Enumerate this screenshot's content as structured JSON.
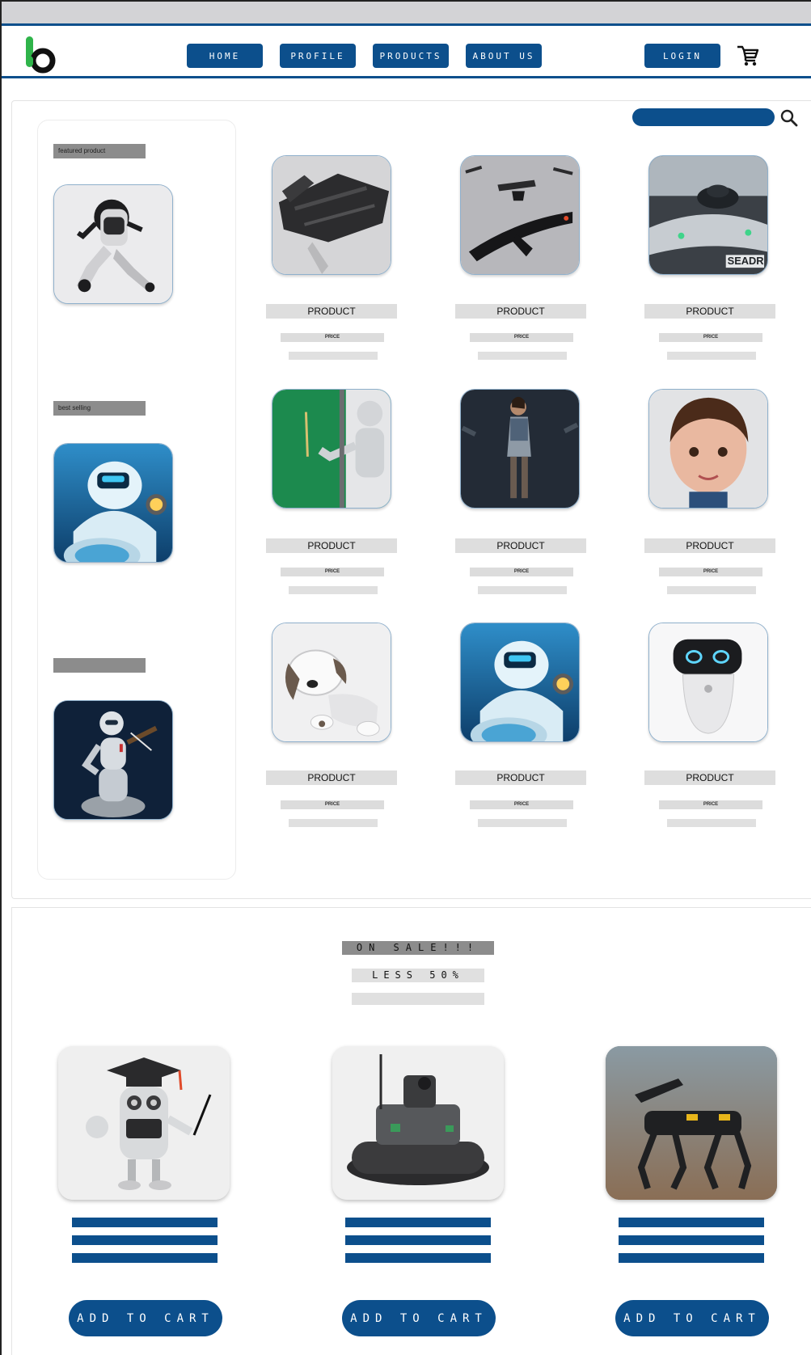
{
  "header": {
    "nav": [
      {
        "label": "HOME"
      },
      {
        "label": "PROFILE"
      },
      {
        "label": "PRODUCTS"
      },
      {
        "label": "ABOUT US"
      }
    ],
    "login_label": "LOGIN"
  },
  "sidebar": {
    "sections": [
      {
        "label": "featured product",
        "image": "humanoid-robot"
      },
      {
        "label": "best selling",
        "image": "blue-robot"
      },
      {
        "label": "",
        "image": "violin-robot"
      }
    ]
  },
  "products": [
    {
      "title": "PRODUCT",
      "price": "PRICE",
      "image": "drone-black"
    },
    {
      "title": "PRODUCT",
      "price": "PRICE",
      "image": "drone-fleet"
    },
    {
      "title": "PRODUCT",
      "price": "PRICE",
      "image": "drone-seadragon"
    },
    {
      "title": "PRODUCT",
      "price": "PRICE",
      "image": "teacher-robot"
    },
    {
      "title": "PRODUCT",
      "price": "PRICE",
      "image": "android-woman"
    },
    {
      "title": "PRODUCT",
      "price": "PRICE",
      "image": "child-android"
    },
    {
      "title": "PRODUCT",
      "price": "PRICE",
      "image": "robot-dog"
    },
    {
      "title": "PRODUCT",
      "price": "PRICE",
      "image": "blue-robot"
    },
    {
      "title": "PRODUCT",
      "price": "PRICE",
      "image": "home-assistant"
    }
  ],
  "sale": {
    "title": "ON SALE!!!",
    "subtitle": "LESS 50%",
    "items": [
      {
        "image": "graduate-robot",
        "button": "ADD TO CART"
      },
      {
        "image": "tracked-robot",
        "button": "ADD TO CART"
      },
      {
        "image": "quadruped-robot",
        "button": "ADD TO CART"
      }
    ]
  },
  "sidebar_watermark": "SEADR",
  "icons": {
    "logo": "brand-logo-icon",
    "cart": "shopping-cart-icon",
    "search": "search-icon"
  },
  "colors": {
    "brand": "#0c4f8c",
    "logo_green": "#2fb44a",
    "label_gray": "#8c8c8c"
  }
}
